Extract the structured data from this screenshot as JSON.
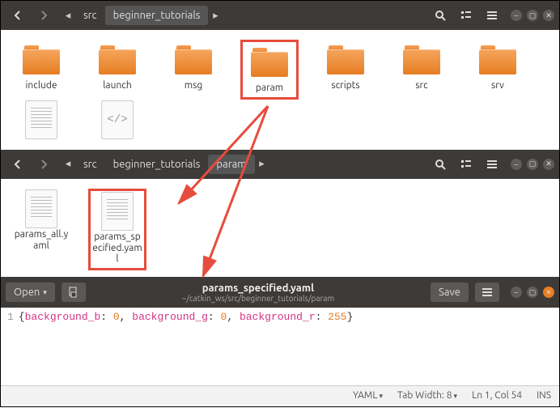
{
  "win1": {
    "breadcrumb": [
      "src",
      "beginner_tutorials"
    ],
    "items": [
      {
        "type": "folder",
        "label": "include"
      },
      {
        "type": "folder",
        "label": "launch"
      },
      {
        "type": "folder",
        "label": "msg"
      },
      {
        "type": "folder",
        "label": "param",
        "highlight": true
      },
      {
        "type": "folder",
        "label": "scripts"
      },
      {
        "type": "folder",
        "label": "src"
      },
      {
        "type": "folder",
        "label": "srv"
      },
      {
        "type": "txt",
        "label": ""
      },
      {
        "type": "code",
        "label": ""
      }
    ]
  },
  "win2": {
    "breadcrumb": [
      "src",
      "beginner_tutorials",
      "param"
    ],
    "items": [
      {
        "type": "txt",
        "label": "params_all.yaml"
      },
      {
        "type": "txt",
        "label": "params_specified.yaml",
        "highlight": true
      }
    ]
  },
  "editor": {
    "open": "Open",
    "save": "Save",
    "title": "params_specified.yaml",
    "path": "~/catkin_ws/src/beginner_tutorials/param",
    "line": "1",
    "code": {
      "k1": "background_b",
      "v1": "0",
      "k2": "background_g",
      "v2": "0",
      "k3": "background_r",
      "v3": "255"
    },
    "status": {
      "lang": "YAML",
      "tabwidth": "Tab Width: 8",
      "pos": "Ln 1, Col 54",
      "ins": "INS"
    }
  }
}
